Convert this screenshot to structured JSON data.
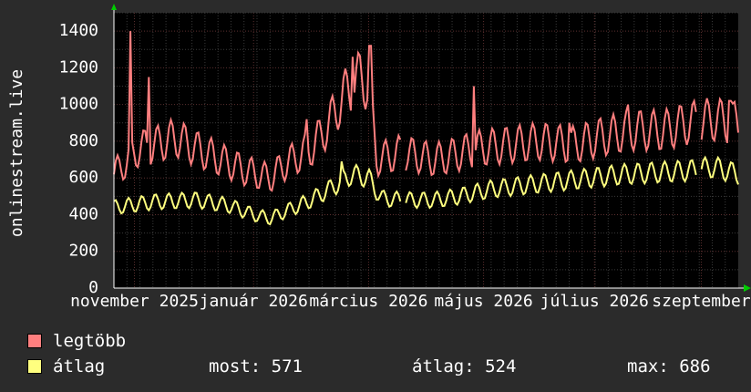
{
  "chart_data": {
    "type": "line",
    "ylabel": "onlinestream.live",
    "y_ticks": [
      "0",
      "200",
      "400",
      "600",
      "800",
      "1000",
      "1200",
      "1400"
    ],
    "ylim": [
      0,
      1500
    ],
    "x_tick_labels": [
      "november 2025",
      "január 2026",
      "március 2026",
      "május 2026",
      "július 2026",
      "szeptember"
    ],
    "x_tick_positions": [
      0.25,
      1.7,
      3.1,
      4.5,
      5.85,
      7.15
    ],
    "x_range": [
      0,
      7.6
    ],
    "grid": true,
    "series": [
      {
        "name": "legtöbb",
        "color": "#ff7f7f",
        "anchors": [
          [
            0,
            620
          ],
          [
            0.3,
            760
          ],
          [
            0.5,
            780
          ],
          [
            0.75,
            820
          ],
          [
            1,
            760
          ],
          [
            1.3,
            700
          ],
          [
            1.6,
            640
          ],
          [
            1.9,
            600
          ],
          [
            2.1,
            680
          ],
          [
            2.4,
            760
          ],
          [
            2.6,
            880
          ],
          [
            2.8,
            1050
          ],
          [
            3.0,
            1150
          ],
          [
            3.1,
            1100
          ],
          [
            3.2,
            700
          ],
          [
            3.5,
            740
          ],
          [
            3.9,
            700
          ],
          [
            4.1,
            720
          ],
          [
            4.4,
            760
          ],
          [
            4.8,
            780
          ],
          [
            5.2,
            800
          ],
          [
            5.6,
            780
          ],
          [
            5.9,
            820
          ],
          [
            6.3,
            860
          ],
          [
            6.7,
            860
          ],
          [
            7.0,
            900
          ],
          [
            7.3,
            920
          ],
          [
            7.6,
            900
          ]
        ],
        "spikes": [
          [
            0.2,
            1400
          ],
          [
            0.43,
            1150
          ],
          [
            2.9,
            1260
          ],
          [
            3.12,
            1320
          ],
          [
            2.35,
            920
          ],
          [
            4.38,
            1100
          ],
          [
            5.55,
            900
          ],
          [
            6.25,
            1000
          ],
          [
            7.5,
            1020
          ]
        ],
        "gaps": [
          [
            3.5,
            3.55
          ],
          [
            7.1,
            7.15
          ]
        ]
      },
      {
        "name": "átlag",
        "color": "#ffff7f",
        "anchors": [
          [
            0,
            440
          ],
          [
            0.5,
            470
          ],
          [
            1,
            480
          ],
          [
            1.4,
            450
          ],
          [
            1.7,
            400
          ],
          [
            1.9,
            380
          ],
          [
            2.1,
            420
          ],
          [
            2.4,
            480
          ],
          [
            2.7,
            560
          ],
          [
            2.9,
            620
          ],
          [
            3.1,
            600
          ],
          [
            3.25,
            490
          ],
          [
            3.5,
            480
          ],
          [
            3.9,
            480
          ],
          [
            4.2,
            500
          ],
          [
            4.6,
            540
          ],
          [
            5.0,
            560
          ],
          [
            5.4,
            580
          ],
          [
            5.8,
            600
          ],
          [
            6.2,
            620
          ],
          [
            6.6,
            630
          ],
          [
            7.0,
            640
          ],
          [
            7.3,
            660
          ],
          [
            7.6,
            620
          ]
        ],
        "spikes": [
          [
            2.78,
            690
          ]
        ],
        "gaps": [
          [
            3.5,
            3.55
          ],
          [
            7.1,
            7.15
          ]
        ]
      }
    ]
  },
  "legend": [
    {
      "label": "legtöbb",
      "color": "#ff7f7f"
    },
    {
      "label": "átlag",
      "color": "#ffff7f"
    }
  ],
  "stats": {
    "most": "most: 571",
    "atlag": "átlag: 524",
    "max": "max: 686"
  },
  "colors": {
    "background": "#2b2b2b",
    "plot_background": "#000000",
    "grid_major": "#5a2f2f",
    "grid_minor": "#3a3a3a",
    "axis_arrow": "#00cc00"
  }
}
